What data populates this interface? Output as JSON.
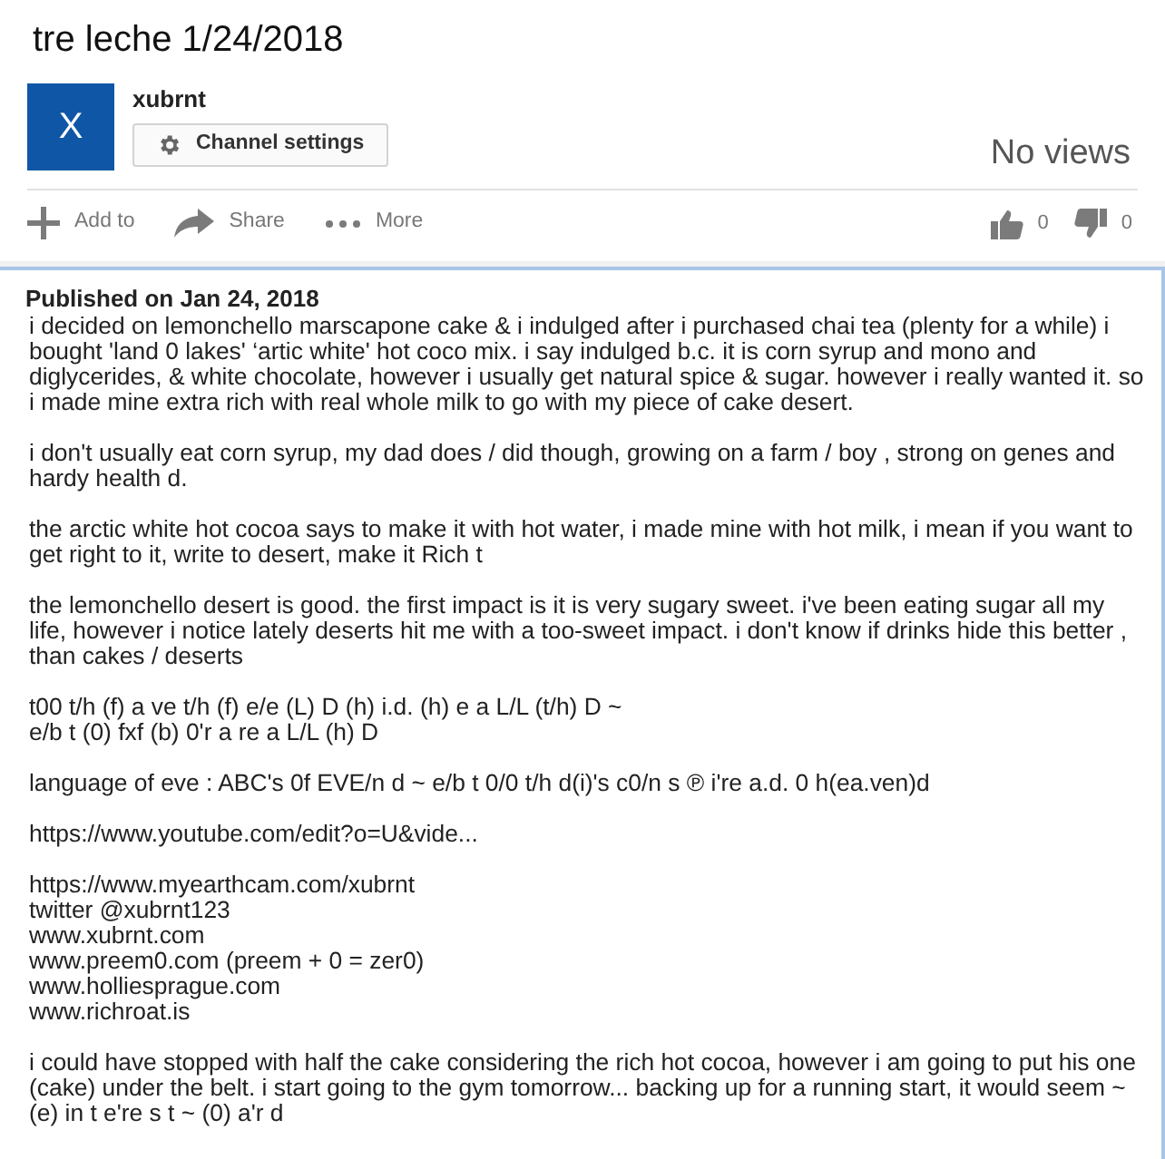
{
  "video": {
    "title": "tre leche 1/24/2018"
  },
  "channel": {
    "avatar_letter": "X",
    "name": "xubrnt",
    "settings_button": "Channel settings"
  },
  "views": "No views",
  "actions": [
    {
      "kind": "add",
      "label": "Add to"
    },
    {
      "kind": "share",
      "label": "Share"
    },
    {
      "kind": "more",
      "label": "More"
    }
  ],
  "ratings": [
    {
      "kind": "like",
      "count": "0"
    },
    {
      "kind": "dislike",
      "count": "0"
    }
  ],
  "description": {
    "published": "Published on Jan 24, 2018",
    "paragraphs": [
      [
        "i decided on lemonchello marscapone cake & i indulged after i purchased chai tea (plenty for a while) i",
        "bought 'land 0 lakes' ‘artic white' hot coco mix. i say indulged b.c. it is corn syrup and mono and",
        "diglycerides, & white chocolate, however i usually get natural spice & sugar. however i really wanted it. so",
        "i made mine extra rich with real whole milk to go with my piece of cake desert."
      ],
      [
        "i don't usually eat corn syrup, my dad does / did though, growing on a farm / boy , strong on genes and",
        "hardy health d."
      ],
      [
        "the arctic white hot cocoa says to make it with hot water, i made mine with hot milk, i mean if you want to",
        "get right to it, write to desert, make it Rich t"
      ],
      [
        "the lemonchello desert is good. the first impact is it is very sugary sweet. i've been eating sugar all my",
        "life, however i notice lately deserts hit me with a too-sweet impact. i don't know if drinks hide this better ,",
        "than cakes / deserts"
      ],
      [
        "t00 t/h (f) a ve t/h (f) e/e (L) D (h) i.d. (h) e a L/L (t/h) D ~",
        "e/b t (0) fxf (b) 0'r a re a L/L (h) D"
      ],
      [
        "language of eve : ABC's 0f EVE/n d ~ e/b t 0/0 t/h d(i)'s c0/n s ℗ i're a.d. 0 h(ea.ven)d"
      ],
      [
        "https://www.youtube.com/edit?o=U&vide..."
      ],
      [
        "https://www.myearthcam.com/xubrnt",
        "twitter @xubrnt123",
        "www.xubrnt.com",
        "www.preem0.com (preem + 0 = zer0)",
        "www.holliesprague.com",
        "www.richroat.is"
      ],
      [
        "i could have stopped with half the cake considering the rich hot cocoa, however i am going to put his one",
        "(cake) under the belt. i start going to the gym tomorrow... backing up for a running start, it would seem ~",
        "(e) in t e're s t ~ (0) a'r d"
      ]
    ]
  }
}
